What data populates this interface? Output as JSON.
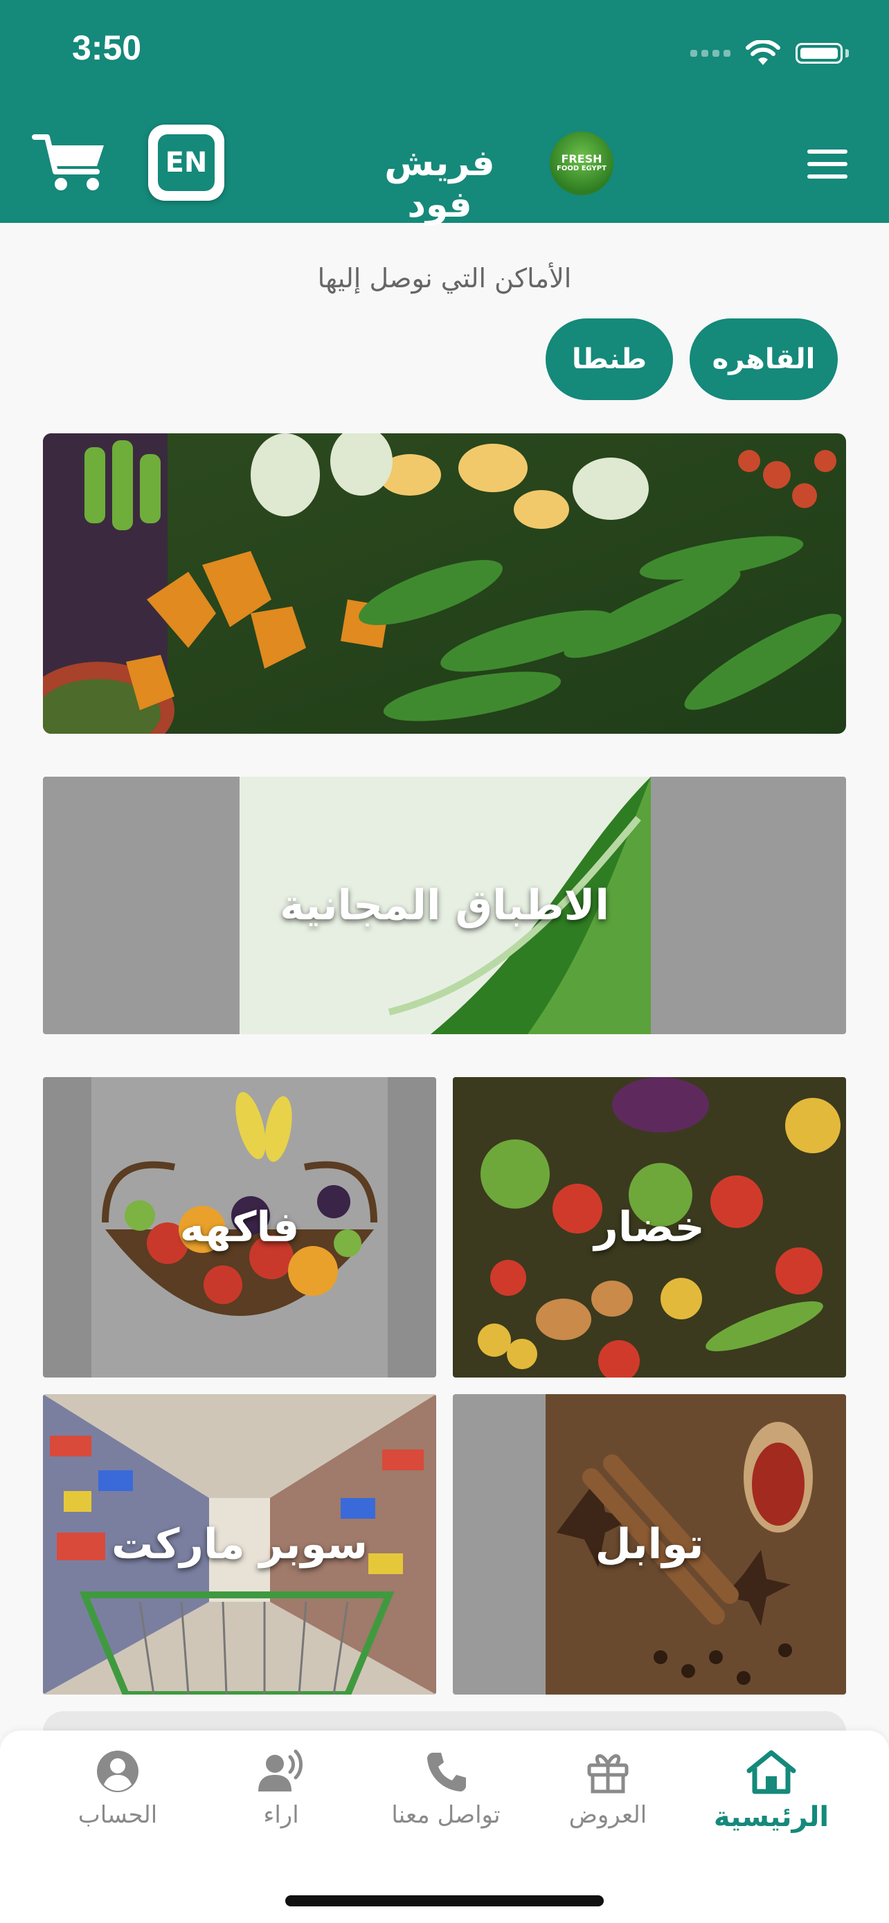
{
  "status_bar": {
    "time": "3:50"
  },
  "header": {
    "title": "فريش فود",
    "lang_button": "EN",
    "logo_text": [
      "FRESH",
      "FOOD EGYPT"
    ],
    "brand_color": "#15897a"
  },
  "delivery": {
    "label": "الأماكن التي نوصل إليها",
    "areas": [
      "القاهره",
      "طنطا"
    ]
  },
  "categories": {
    "free_dishes": "الاطباق المجانية",
    "vegetables": "خضار",
    "fruits": "فاكهه",
    "spices": "توابل",
    "supermarket": "سوبر ماركت"
  },
  "bottom_nav": [
    {
      "label": "الرئيسية",
      "icon": "home-icon",
      "active": true
    },
    {
      "label": "العروض",
      "icon": "gift-icon",
      "active": false
    },
    {
      "label": "تواصل معنا",
      "icon": "phone-icon",
      "active": false
    },
    {
      "label": "اراء",
      "icon": "speaking-person-icon",
      "active": false
    },
    {
      "label": "الحساب",
      "icon": "account-icon",
      "active": false
    }
  ]
}
